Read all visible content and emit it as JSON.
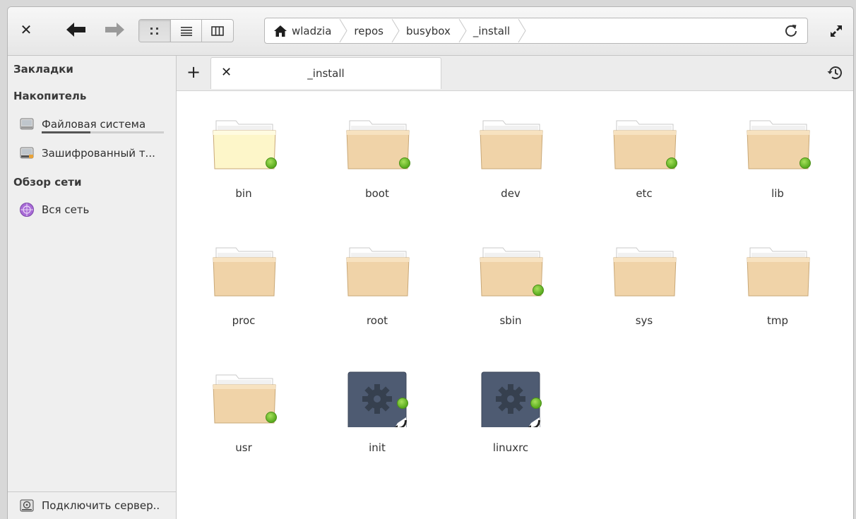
{
  "headerbar": {
    "close_icon": "close-icon",
    "back_icon": "back-arrow-icon",
    "forward_icon": "forward-arrow-icon",
    "view_modes": [
      "grid-view-icon",
      "list-view-icon",
      "columns-view-icon"
    ],
    "active_view": "grid-view-icon",
    "breadcrumbs": [
      "wladzia",
      "repos",
      "busybox",
      "_install"
    ],
    "reload_icon": "reload-icon",
    "maximize_icon": "maximize-icon"
  },
  "sidebar": {
    "bookmarks_heading": "Закладки",
    "storage_heading": "Накопитель",
    "storage_items": [
      {
        "label": "Файловая система",
        "icon": "drive-icon",
        "usage": 0.4
      },
      {
        "label": "Зашифрованный т...",
        "icon": "encrypted-drive-icon"
      }
    ],
    "network_heading": "Обзор сети",
    "network_items": [
      {
        "label": "Вся сеть",
        "icon": "network-icon"
      }
    ],
    "connect_server": "Подключить сервер.."
  },
  "tabs": {
    "add_icon": "add-tab-icon",
    "items": [
      {
        "label": "_install",
        "close_icon": "close-tab-icon"
      }
    ],
    "history_icon": "history-icon"
  },
  "files": [
    {
      "name": "bin",
      "type": "folder",
      "badge": true,
      "highlight": true
    },
    {
      "name": "boot",
      "type": "folder",
      "badge": true
    },
    {
      "name": "dev",
      "type": "folder",
      "badge": false
    },
    {
      "name": "etc",
      "type": "folder",
      "badge": true
    },
    {
      "name": "lib",
      "type": "folder",
      "badge": true
    },
    {
      "name": "proc",
      "type": "folder",
      "badge": false
    },
    {
      "name": "root",
      "type": "folder",
      "badge": false
    },
    {
      "name": "sbin",
      "type": "folder",
      "badge": true
    },
    {
      "name": "sys",
      "type": "folder",
      "badge": false
    },
    {
      "name": "tmp",
      "type": "folder",
      "badge": false
    },
    {
      "name": "usr",
      "type": "folder",
      "badge": true
    },
    {
      "name": "init",
      "type": "executable-link",
      "badge": true
    },
    {
      "name": "linuxrc",
      "type": "executable-link",
      "badge": true
    }
  ],
  "colors": {
    "folder": "#f0d3a8",
    "folder_highlight": "#fdf6c9",
    "executable": "#4e5b72",
    "badge": "#6dbf2a"
  }
}
